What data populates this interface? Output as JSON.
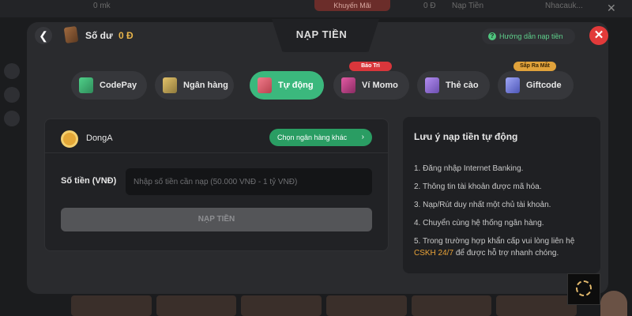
{
  "background": {
    "top_left_text": "0 mk",
    "promo_label": "Khuyến Mãi",
    "balance_dim": "0 Đ",
    "deposit_dim": "Nạp Tiền",
    "user_dim": "Nhacauk..."
  },
  "header": {
    "title": "NẠP TIỀN",
    "balance_label": "Số dư",
    "balance_value": "0 Đ",
    "guide_label": "Hướng dẫn nạp tiền"
  },
  "tabs": [
    {
      "label": "CodePay",
      "active": false
    },
    {
      "label": "Ngân hàng",
      "active": false
    },
    {
      "label": "Tự động",
      "active": true
    },
    {
      "label": "Ví Momo",
      "tag": "Bảo Trì",
      "active": false
    },
    {
      "label": "Thẻ cào",
      "active": false
    },
    {
      "label": "Giftcode",
      "tag": "Sắp Ra Mắt",
      "active": false
    }
  ],
  "bank": {
    "name": "DongA",
    "choose_label": "Chọn ngân hàng khác"
  },
  "form": {
    "amount_label": "Số tiền (VNĐ)",
    "amount_placeholder": "Nhập số tiền cần nạp (50.000 VNĐ - 1 tỷ VNĐ)",
    "amount_value": "",
    "submit_label": "NẠP TIỀN"
  },
  "notes": {
    "title": "Lưu ý nạp tiền tự động",
    "items": [
      "1. Đăng nhập Internet Banking.",
      "2. Thông tin tài khoản được mã hóa.",
      "3. Nạp/Rút duy nhất một chủ tài khoản.",
      "4. Chuyển cùng hệ thống ngân hàng."
    ],
    "item5_prefix": "5. Trong trường hợp khẩn cấp vui lòng liên hệ",
    "item5_link": "CSKH 24/7",
    "item5_suffix": "để được hỗ trợ nhanh chóng."
  },
  "colors": {
    "accent_green": "#3bb87d",
    "close_red": "#e23a3a",
    "balance_gold": "#e8b44a",
    "link_orange": "#e8a238"
  }
}
